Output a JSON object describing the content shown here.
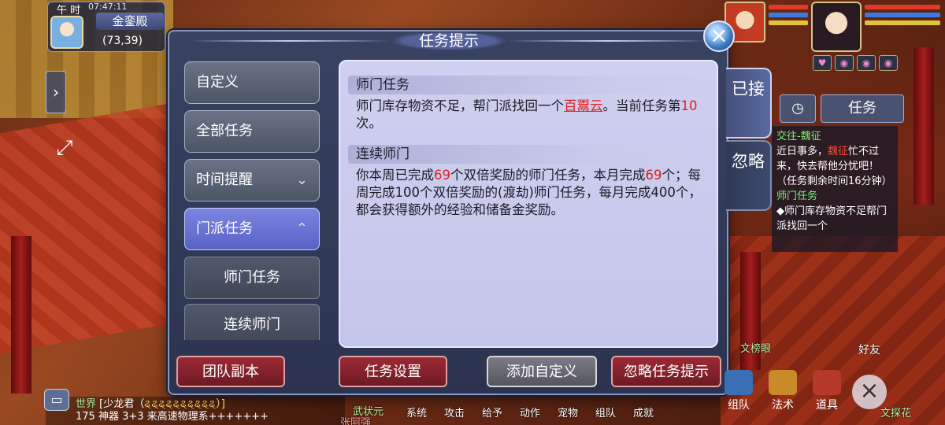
{
  "location": {
    "time_period": "午 时",
    "clock": "07:47:11",
    "map_name": "金銮殿",
    "coords": "(73,39)"
  },
  "dialog": {
    "title": "任务提示",
    "close_icon": "close-icon"
  },
  "menu": {
    "items": [
      {
        "label": "自定义"
      },
      {
        "label": "全部任务"
      },
      {
        "label": "时间提醒",
        "chevron": "chevron-down-icon"
      },
      {
        "label": "门派任务",
        "chevron": "chevron-up-icon",
        "active": true
      }
    ],
    "subitems": [
      {
        "label": "师门任务"
      },
      {
        "label": "连续师门"
      }
    ]
  },
  "content": {
    "section1": {
      "title": "师门任务",
      "text_a": "师门库存物资不足，帮门派找回一个",
      "link": "百鬻云",
      "text_b": "。当前任务第",
      "count": "10",
      "text_c": "次。"
    },
    "section2": {
      "title": "连续师门",
      "text_a": "你本周已完成",
      "n1": "69",
      "text_b": "个双倍奖励的师门任务，本月完成",
      "n2": "69",
      "text_c": "个；每周完成100个双倍奖励的(渡劫)师门任务，每月完成400个，都会获得额外的经验和储备金奖励。"
    }
  },
  "side_tabs": {
    "accepted": "已接",
    "ignored": "忽略"
  },
  "buttons": {
    "team_dungeon": "团队副本",
    "task_settings": "任务设置",
    "add_custom": "添加自定义",
    "ignore_hints": "忽略任务提示"
  },
  "tracker": {
    "tab_task": "任务",
    "entry1_title": "交往-魏征",
    "entry1_a": "近日事多，",
    "entry1_name": "魏征",
    "entry1_b": "忙不过来，快去帮他分忧吧！（任务剩余时间16分钟）",
    "entry2_title": "师门任务",
    "entry2_text": "◆师门库存物资不足帮门派找回一个"
  },
  "chat": {
    "channel": "世界",
    "line1_user": "[少龙君（",
    "line1_tail": "ୡୡୡୡୡୡୡୡୡୡ）]",
    "line2": "175 神器 3+3  来高速物理系+++++++"
  },
  "hud": {
    "left_items": [
      "系统",
      "攻击",
      "给予",
      "动作",
      "宠物",
      "组队",
      "成就"
    ],
    "right_items": [
      "组队",
      "法术",
      "道具"
    ],
    "friends": "好友"
  },
  "npc_names": {
    "n1": "文榜眼",
    "n2": "武状元",
    "n3": "文探花",
    "n4": "张阿强"
  },
  "colors": {
    "accent_red": "#e02020",
    "menu_active": "#6b74d6",
    "panel_bg": "#c9caee"
  }
}
